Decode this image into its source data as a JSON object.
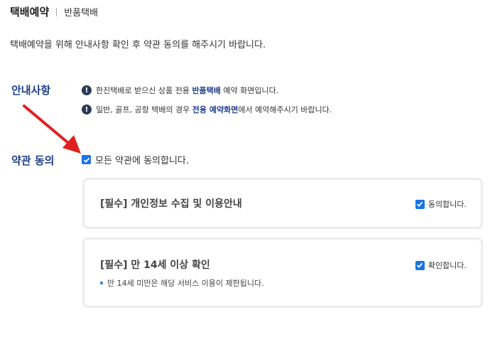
{
  "header": {
    "title": "택배예약",
    "subtitle": "반품택배"
  },
  "intro": "택배예약을 위해 안내사항 확인 후 약관 동의를 해주시기 바랍니다.",
  "notice_section": {
    "label": "안내사항",
    "line1": {
      "pre": "한진택배로 받으신 상품 전용 ",
      "highlight": "반품택배",
      "post": " 예약 화면입니다."
    },
    "line2": {
      "pre": "일반, 골프, 공항 택배의 경우 ",
      "highlight": "전용 예약화면",
      "post": "에서 예약해주시기 바랍니다."
    }
  },
  "terms_section": {
    "label": "약관 동의",
    "agree_all": "모든 약관에 동의합니다.",
    "items": [
      {
        "title": "[필수] 개인정보 수집 및 이용안내",
        "check_label": "동의합니다."
      },
      {
        "title": "[필수] 만 14세 이상 확인",
        "check_label": "확인합니다.",
        "note": "만 14세 미만은 해당 서비스 이용이 제한됩니다."
      }
    ]
  },
  "colors": {
    "accent": "#1f3f8a",
    "checkbox": "#1a73e8",
    "arrow": "#e02020"
  },
  "icons": {
    "info": "exclamation-circle-icon",
    "check": "checkmark-icon",
    "pointer": "red-arrow-annotation"
  }
}
